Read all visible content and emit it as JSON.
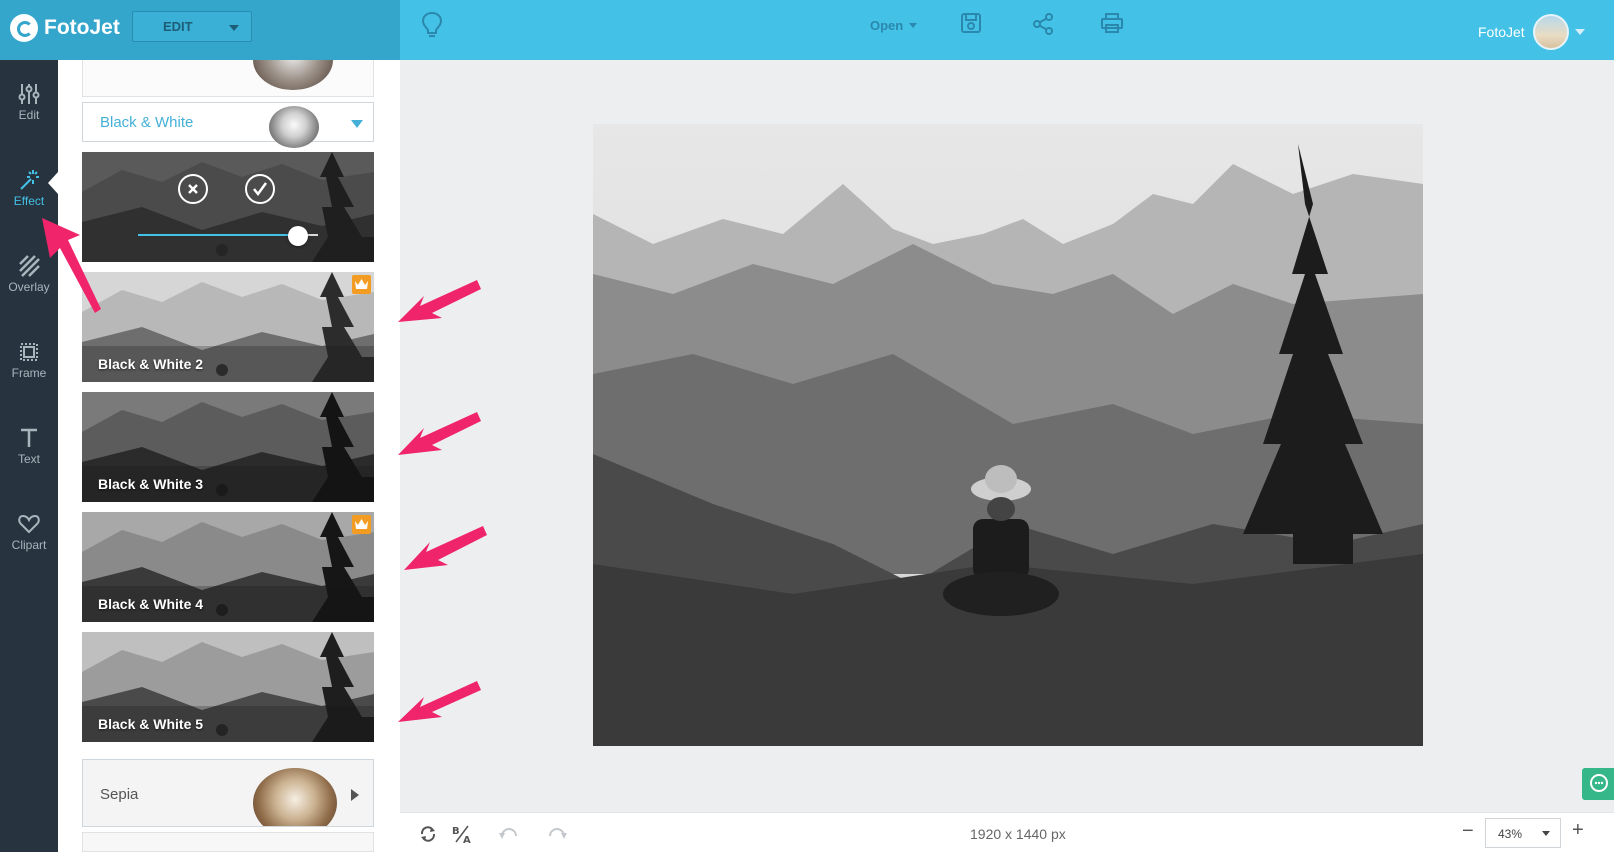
{
  "app": {
    "name": "FotoJet",
    "mode_select": "EDIT"
  },
  "header": {
    "open_label": "Open",
    "user_name": "FotoJet"
  },
  "nav": {
    "items": [
      {
        "label": "Edit",
        "icon": "sliders-icon"
      },
      {
        "label": "Effect",
        "icon": "magic-wand-icon"
      },
      {
        "label": "Overlay",
        "icon": "stripes-icon"
      },
      {
        "label": "Frame",
        "icon": "frame-icon"
      },
      {
        "label": "Text",
        "icon": "text-icon"
      },
      {
        "label": "Clipart",
        "icon": "heart-icon"
      }
    ],
    "active": "Effect"
  },
  "panel": {
    "category": "Black & White",
    "effects": [
      {
        "label": "Black & White 2",
        "premium": true
      },
      {
        "label": "Black & White 3",
        "premium": false
      },
      {
        "label": "Black & White 4",
        "premium": true
      },
      {
        "label": "Black & White 5",
        "premium": false
      }
    ],
    "next_category": "Sepia"
  },
  "canvas": {
    "dimensions": "1920 x 1440 px"
  },
  "zoom": {
    "value": "43%"
  },
  "colors": {
    "accent": "#44c1e6",
    "topbar_left": "#34a6cc",
    "nav_bg": "#27343f",
    "premium": "#f39c24",
    "annotation_arrow": "#f0246a",
    "chat": "#35b78a"
  }
}
